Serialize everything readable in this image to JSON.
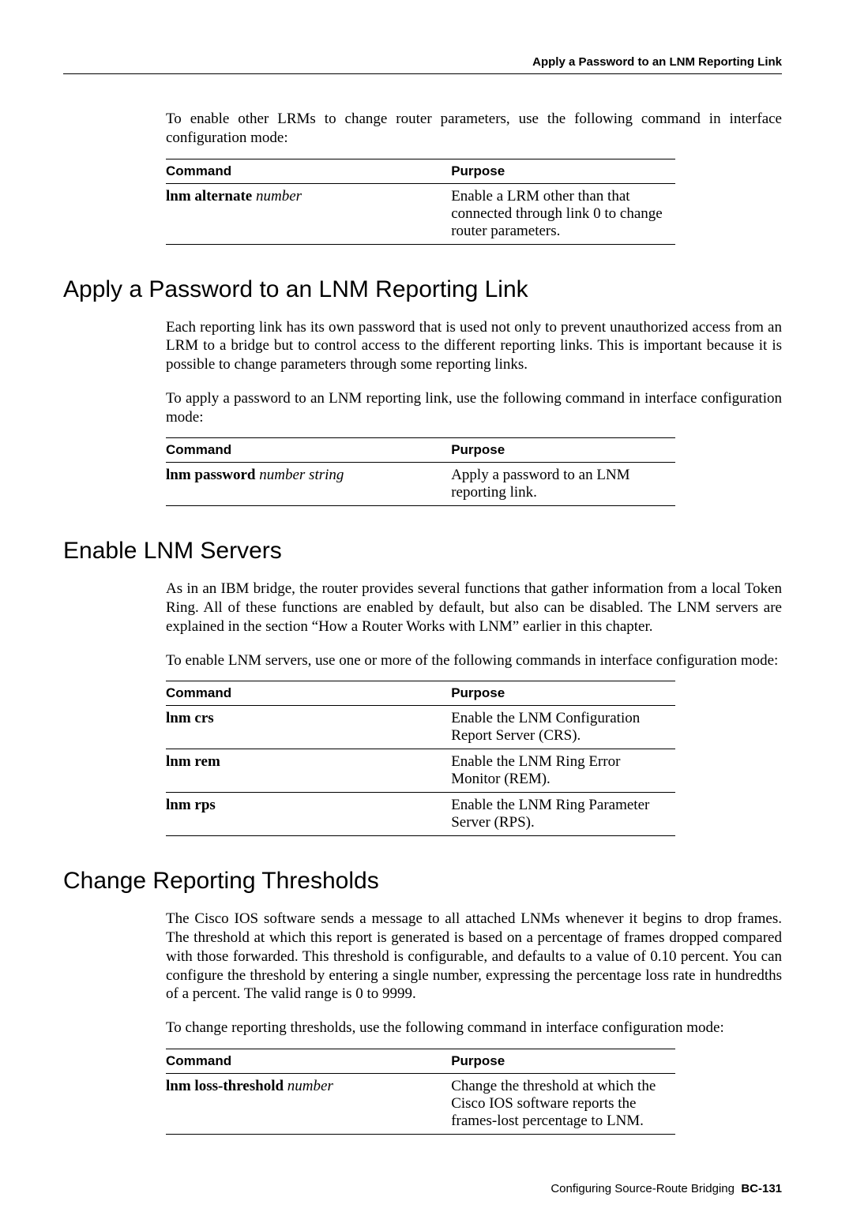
{
  "header": {
    "title": "Apply a Password to an LNM Reporting Link"
  },
  "intro_para": "To enable other LRMs to change router parameters, use the following command in interface configuration mode:",
  "table_headers": {
    "command": "Command",
    "purpose": "Purpose"
  },
  "table_intro": {
    "rows": [
      {
        "cmd_bold": "lnm alternate",
        "cmd_ital": "number",
        "purpose": "Enable a LRM other than that connected through link 0 to change router parameters."
      }
    ]
  },
  "section_password": {
    "heading": "Apply a Password to an LNM Reporting Link",
    "para1": "Each reporting link has its own password that is used not only to prevent unauthorized access from an LRM to a bridge but to control access to the different reporting links. This is important because it is possible to change parameters through some reporting links.",
    "para2": "To apply a password to an LNM reporting link, use the following command in interface configuration mode:",
    "rows": [
      {
        "cmd_bold": "lnm password",
        "cmd_ital": "number string",
        "purpose": "Apply a password to an LNM reporting link."
      }
    ]
  },
  "section_enable": {
    "heading": "Enable LNM Servers",
    "para1": "As in an IBM bridge, the router provides several functions that gather information from a local Token Ring. All of these functions are enabled by default, but also can be disabled. The LNM servers are explained in the section “How a Router Works with LNM” earlier in this chapter.",
    "para2": "To enable LNM servers, use one or more of the following commands in interface configuration mode:",
    "rows": [
      {
        "cmd_bold": "lnm crs",
        "cmd_ital": "",
        "purpose": "Enable the LNM Configuration Report Server (CRS)."
      },
      {
        "cmd_bold": "lnm rem",
        "cmd_ital": "",
        "purpose": "Enable the LNM Ring Error Monitor (REM)."
      },
      {
        "cmd_bold": "lnm rps",
        "cmd_ital": "",
        "purpose": "Enable the LNM Ring Parameter Server (RPS)."
      }
    ]
  },
  "section_thresholds": {
    "heading": "Change Reporting Thresholds",
    "para1": "The Cisco IOS software sends a message to all attached LNMs whenever it begins to drop frames. The threshold at which this report is generated is based on a percentage of frames dropped compared with those forwarded. This threshold is configurable, and defaults to a value of 0.10 percent. You can configure the threshold by entering a single number, expressing the percentage loss rate in hundredths of a percent. The valid range is 0 to 9999.",
    "para2": "To change reporting thresholds, use the following command in interface configuration mode:",
    "rows": [
      {
        "cmd_bold": "lnm loss-threshold",
        "cmd_ital": "number",
        "purpose": "Change the threshold at which the Cisco IOS software reports the frames-lost percentage to LNM."
      }
    ]
  },
  "footer": {
    "text": "Configuring Source-Route Bridging",
    "pageno": "BC-131"
  }
}
